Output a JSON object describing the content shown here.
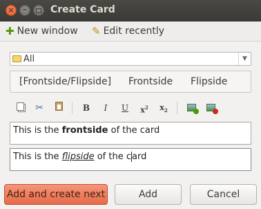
{
  "window": {
    "title": "Create Card"
  },
  "menu": {
    "new_window": "New window",
    "edit_recently": "Edit recently"
  },
  "deck": {
    "selected": "All"
  },
  "tabs": [
    "[Frontside/Flipside]",
    "Frontside",
    "Flipside"
  ],
  "fields": {
    "front": {
      "prefix": "This is the ",
      "bold": "frontside",
      "suffix": " of the card"
    },
    "back": {
      "prefix": "This is the ",
      "emphasis": "flipside",
      "suffix_a": " of the c",
      "suffix_b": "ard"
    }
  },
  "buttons": {
    "add_and_create_next": "Add and create next",
    "add": "Add",
    "cancel": "Cancel"
  },
  "colors": {
    "titlebar": "#3b3a36",
    "primary_button": "#e56b49",
    "close_button": "#e35a2a"
  }
}
